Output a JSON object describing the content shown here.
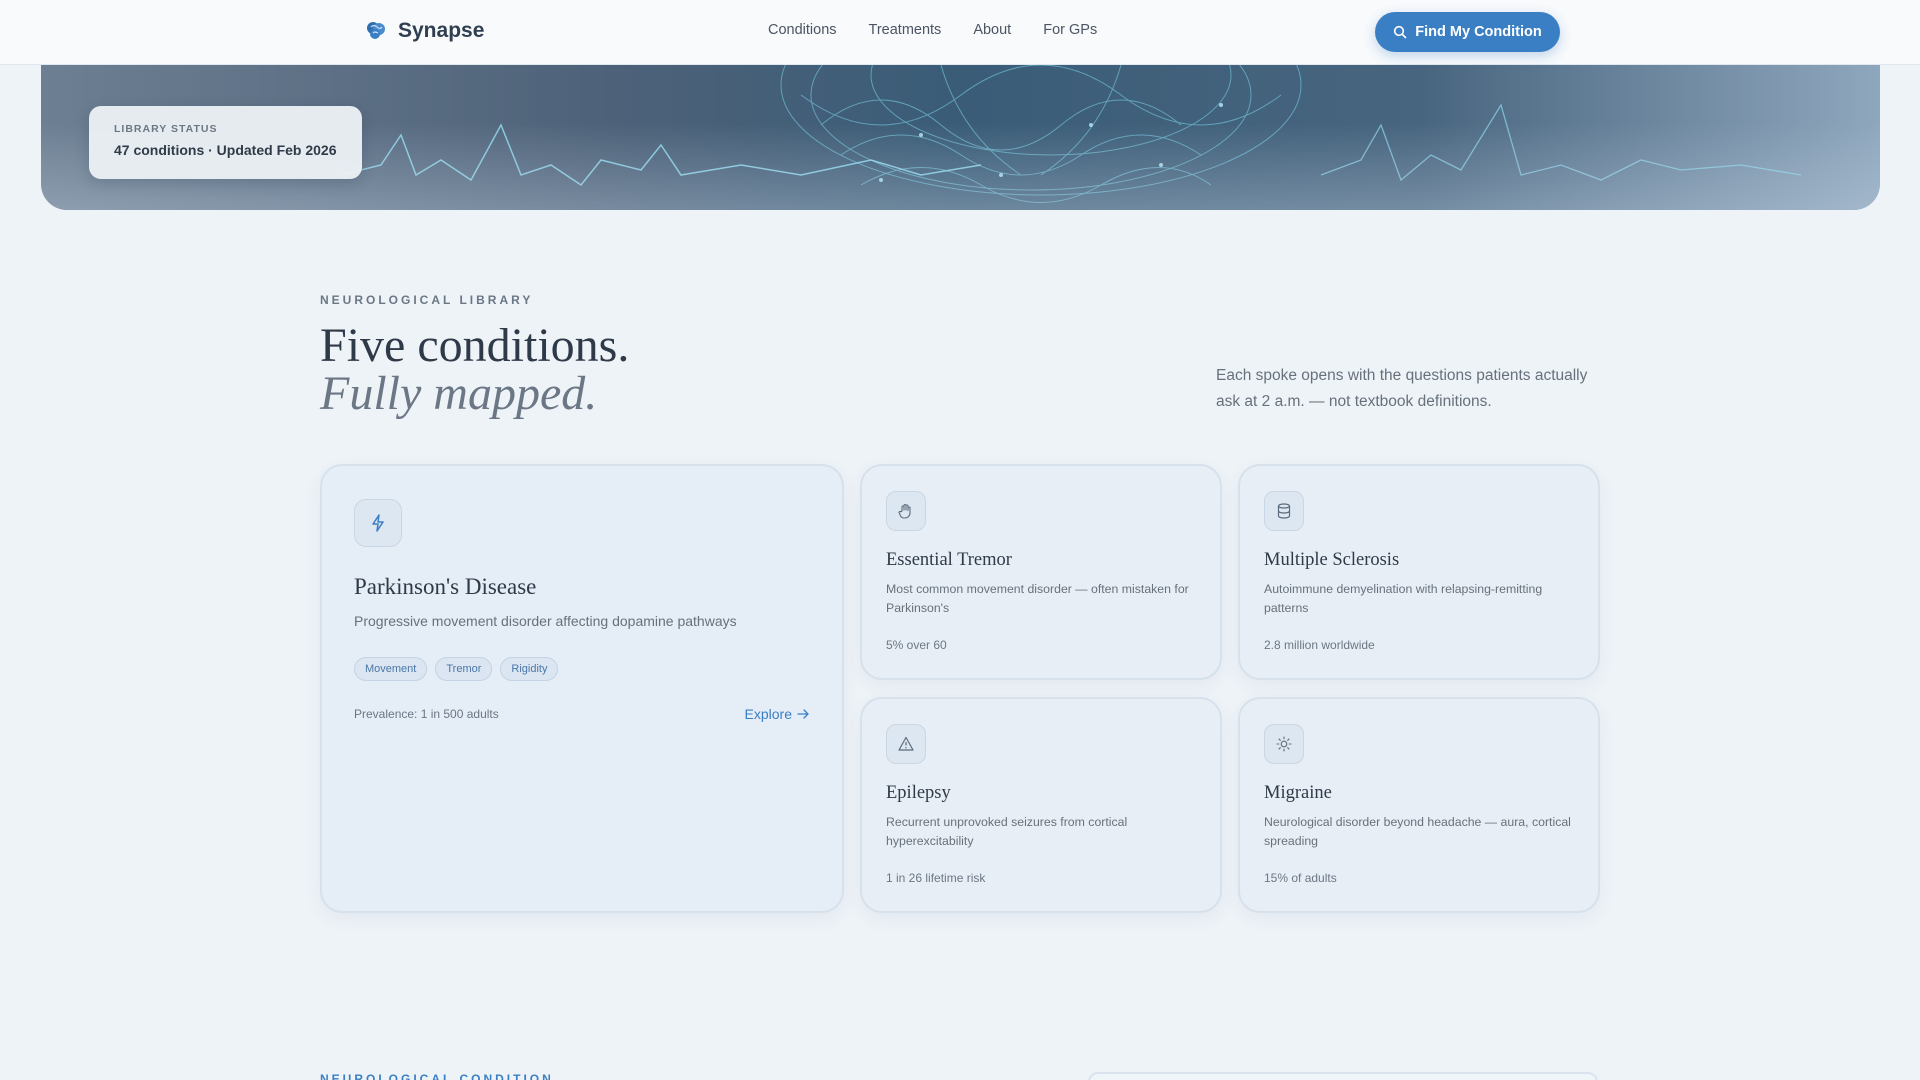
{
  "nav": {
    "brand": "Synapse",
    "links": [
      "Conditions",
      "Treatments",
      "About",
      "For GPs"
    ],
    "cta": "Find My Condition"
  },
  "status": {
    "label": "LIBRARY STATUS",
    "value": "47 conditions · Updated Feb 2026"
  },
  "section": {
    "eyebrow": "NEUROLOGICAL LIBRARY",
    "title_line1": "Five conditions.",
    "title_line2": "Fully mapped.",
    "intro": "Each spoke opens with the questions patients actually ask at 2 a.m. — not textbook definitions."
  },
  "featured": {
    "icon": "lightning-icon",
    "title": "Parkinson's Disease",
    "description": "Progressive movement disorder affecting dopamine pathways",
    "tags": [
      "Movement",
      "Tremor",
      "Rigidity"
    ],
    "stat": "Prevalence: 1 in 500 adults",
    "link": "Explore"
  },
  "cards": [
    {
      "icon": "hand-icon",
      "title": "Essential Tremor",
      "description": "Most common movement disorder — often mistaken for Parkinson's",
      "stat": "5% over 60"
    },
    {
      "icon": "database-icon",
      "title": "Multiple Sclerosis",
      "description": "Autoimmune demyelination with relapsing-remitting patterns",
      "stat": "2.8 million worldwide"
    },
    {
      "icon": "warning-triangle-icon",
      "title": "Epilepsy",
      "description": "Recurrent unprovoked seizures from cortical hyperexcitability",
      "stat": "1 in 26 lifetime risk"
    },
    {
      "icon": "sun-icon",
      "title": "Migraine",
      "description": "Neurological disorder beyond headache — aura, cortical spreading",
      "stat": "15% of adults"
    }
  ],
  "next_section": {
    "eyebrow": "NEUROLOGICAL CONDITION"
  },
  "colors": {
    "accent": "#3a7fc4",
    "background": "#eef3f8"
  }
}
